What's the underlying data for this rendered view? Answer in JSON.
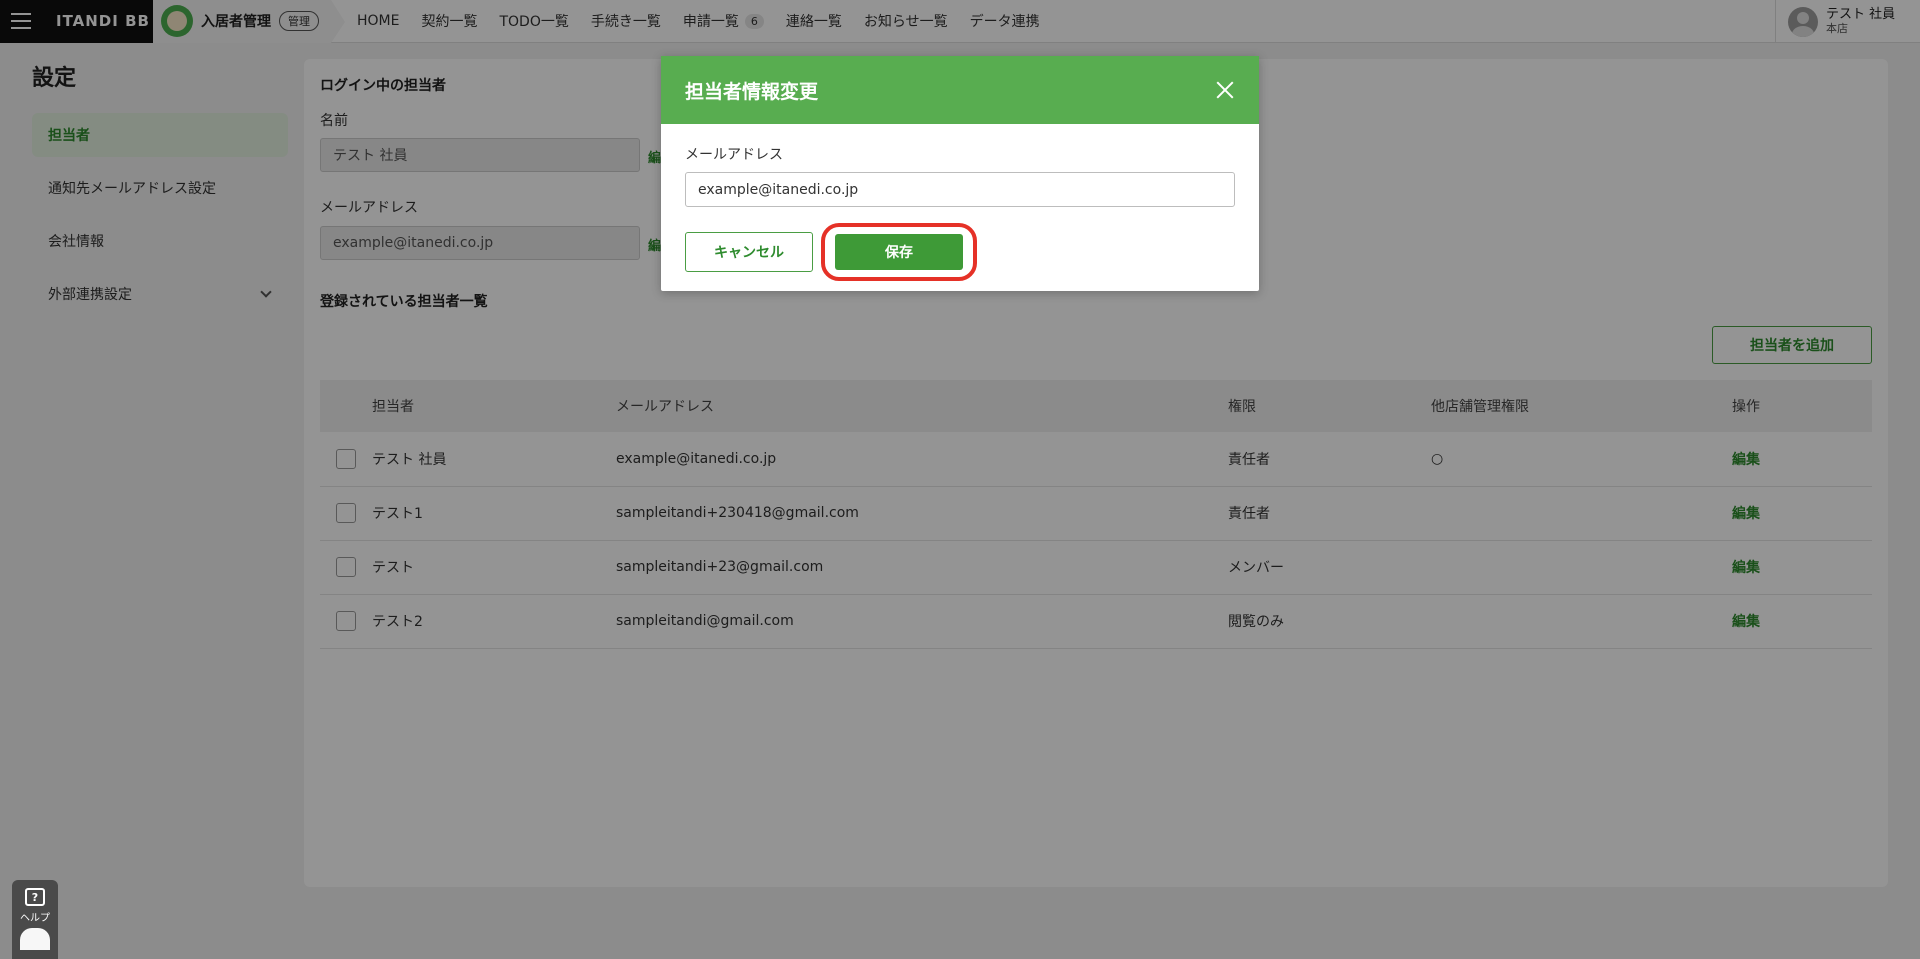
{
  "topbar": {
    "brand": "ITANDI BB",
    "product": "入居者管理",
    "admin_badge": "管理",
    "nav": [
      {
        "label": "HOME"
      },
      {
        "label": "契約一覧"
      },
      {
        "label": "TODO一覧"
      },
      {
        "label": "手続き一覧"
      },
      {
        "label": "申請一覧",
        "count": "6"
      },
      {
        "label": "連絡一覧"
      },
      {
        "label": "お知らせ一覧"
      },
      {
        "label": "データ連携"
      }
    ],
    "user": {
      "name": "テスト 社員",
      "branch": "本店"
    }
  },
  "page_title": "設定",
  "sidebar": {
    "items": [
      {
        "label": "担当者"
      },
      {
        "label": "通知先メールアドレス設定"
      },
      {
        "label": "会社情報"
      },
      {
        "label": "外部連携設定"
      }
    ]
  },
  "login_section": {
    "title": "ログイン中の担当者",
    "name_label": "名前",
    "name_value": "テスト 社員",
    "email_label": "メールアドレス",
    "email_value": "example@itanedi.co.jp",
    "edit_label": "編"
  },
  "list_section": {
    "title": "登録されている担当者一覧",
    "add_button": "担当者を追加",
    "columns": [
      "担当者",
      "メールアドレス",
      "権限",
      "他店舗管理権限",
      "操作"
    ],
    "rows": [
      {
        "name": "テスト 社員",
        "email": "example@itanedi.co.jp",
        "role": "責任者",
        "other_store": "○",
        "action": "編集"
      },
      {
        "name": "テスト1",
        "email": "sampleitandi+230418@gmail.com",
        "role": "責任者",
        "other_store": "",
        "action": "編集"
      },
      {
        "name": "テスト",
        "email": "sampleitandi+23@gmail.com",
        "role": "メンバー",
        "other_store": "",
        "action": "編集"
      },
      {
        "name": "テスト2",
        "email": "sampleitandi@gmail.com",
        "role": "閲覧のみ",
        "other_store": "",
        "action": "編集"
      }
    ]
  },
  "modal": {
    "title": "担当者情報変更",
    "email_label": "メールアドレス",
    "email_value": "example@itanedi.co.jp",
    "cancel_label": "キャンセル",
    "save_label": "保存"
  },
  "help": {
    "label": "ヘルプ",
    "icon_text": "?"
  },
  "colors": {
    "accent_green": "#58ad50",
    "button_green": "#3e9a37",
    "highlight_red": "#e53127"
  }
}
